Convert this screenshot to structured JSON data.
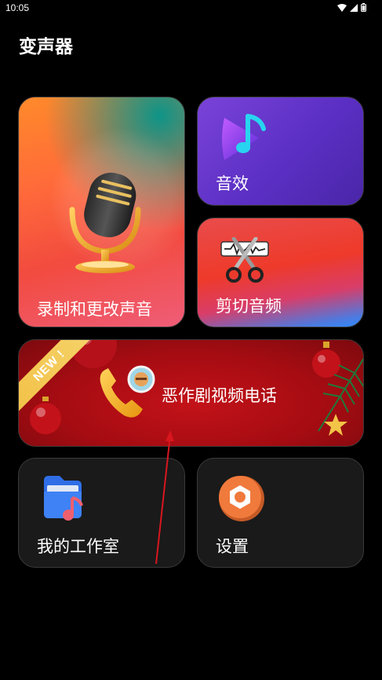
{
  "status_bar": {
    "time": "10:05",
    "icons": [
      "wifi-icon",
      "signal-icon",
      "battery-icon"
    ]
  },
  "app": {
    "title": "变声器"
  },
  "cards": {
    "record": {
      "label": "录制和更改声音",
      "icon": "microphone-icon"
    },
    "effects": {
      "label": "音效",
      "icon": "music-note-icon"
    },
    "cut": {
      "label": "剪切音频",
      "icon": "scissors-waveform-icon"
    },
    "prank": {
      "label": "恶作剧视频电话",
      "badge": "NEW !",
      "icon": "phone-icon"
    },
    "workspace": {
      "label": "我的工作室",
      "icon": "music-folder-icon"
    },
    "settings": {
      "label": "设置",
      "icon": "gear-icon"
    }
  },
  "colors": {
    "background": "#000000",
    "tile": "#1a1a1a",
    "accent_orange": "#ff7a2e",
    "accent_purple": "#6a3bd0",
    "banner_red": "#b8101a"
  }
}
